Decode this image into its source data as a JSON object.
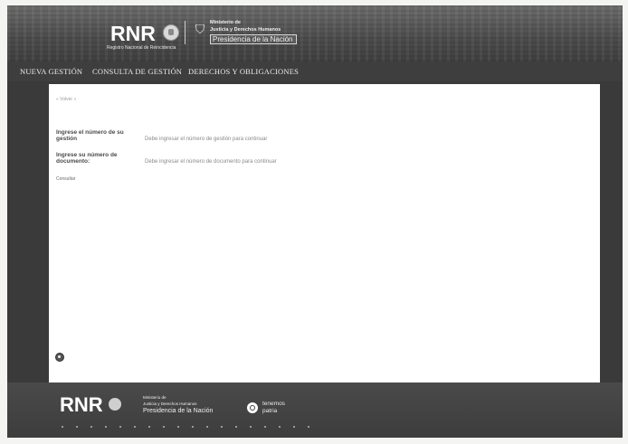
{
  "header": {
    "logo": "RNR",
    "logo_subtitle": "Registro Nacional de Reincidencia",
    "ministry_line1": "Ministerio de",
    "ministry_line2": "Justicia y Derechos Humanos",
    "ministry_line3": "Presidencia de la Nación"
  },
  "nav": {
    "items": [
      {
        "label": "NUEVA GESTIÓN"
      },
      {
        "label": "CONSULTA DE GESTIÓN"
      },
      {
        "label": "DERECHOS Y OBLIGACIONES"
      }
    ]
  },
  "form": {
    "breadcrumb": "« Volver »",
    "gestion_label": "Ingrese el número de su gestión",
    "gestion_placeholder": "Debe ingresar el número de gestión para continuar",
    "documento_label": "Ingrese su número de documento:",
    "documento_placeholder": "Debe ingresar el número de documento para continuar",
    "consultar_label": "Consultar"
  },
  "footer": {
    "logo": "RNR",
    "ministry_line1": "Ministerio de",
    "ministry_line2": "Justicia y Derechos Humanos",
    "ministry_line3": "Presidencia de la Nación",
    "patria_line1": "tenemos",
    "patria_line2": "patria"
  }
}
